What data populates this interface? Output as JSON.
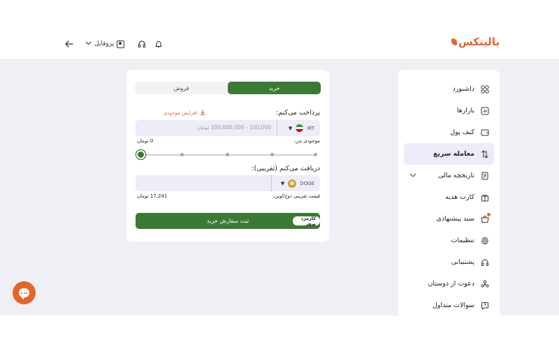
{
  "header": {
    "logo": "بالینکس",
    "profile_label": "پروفایل",
    "icons": [
      "back-arrow-icon",
      "chevron-down-icon",
      "user-icon",
      "headset-icon",
      "bell-icon"
    ]
  },
  "sidebar": {
    "items": [
      {
        "label": "داشبورد",
        "icon": "dashboard-icon"
      },
      {
        "label": "بازارها",
        "icon": "markets-icon"
      },
      {
        "label": "کیف پول",
        "icon": "wallet-icon"
      },
      {
        "label": "معامله سریع",
        "icon": "swap-icon",
        "active": true
      },
      {
        "label": "تاریخچه مالی",
        "icon": "history-icon",
        "has_caret": true
      },
      {
        "label": "کارت هدیه",
        "icon": "gift-icon"
      },
      {
        "label": "سبد پیشنهادی",
        "icon": "basket-icon",
        "badge": true
      },
      {
        "label": "تنظیمات",
        "icon": "gear-icon"
      },
      {
        "label": "پشتیبانی",
        "icon": "headset-icon"
      },
      {
        "label": "دعوت از دوستان",
        "icon": "invite-icon"
      },
      {
        "label": "سوالات متداول",
        "icon": "faq-icon"
      }
    ]
  },
  "trade": {
    "tab_buy": "خرید",
    "tab_sell": "فروش",
    "pay_label": "پرداخت می‌کنم:",
    "increase_balance": "افزایش موجودی",
    "pay_placeholder": "100,000 - 100,000,000 تومان",
    "pay_currency": "IRT",
    "my_balance_label": "موجودی من:",
    "my_balance_value": "0 تومان",
    "slider_percent": 0,
    "receive_label": "دریافت می‌کنم (تقریبی):",
    "receive_currency": "DOGE",
    "price_label": "قیمت تقریبی دوج‌کوین:",
    "price_value": "17,241 تومان",
    "submit_label": "ثبت سفارش خرید",
    "fee_badge": "کارمزد صفر"
  },
  "colors": {
    "brand": "#e8652a",
    "primary_green": "#3a7a35",
    "background": "#eef0f5",
    "input_bg": "#eeecf8"
  }
}
